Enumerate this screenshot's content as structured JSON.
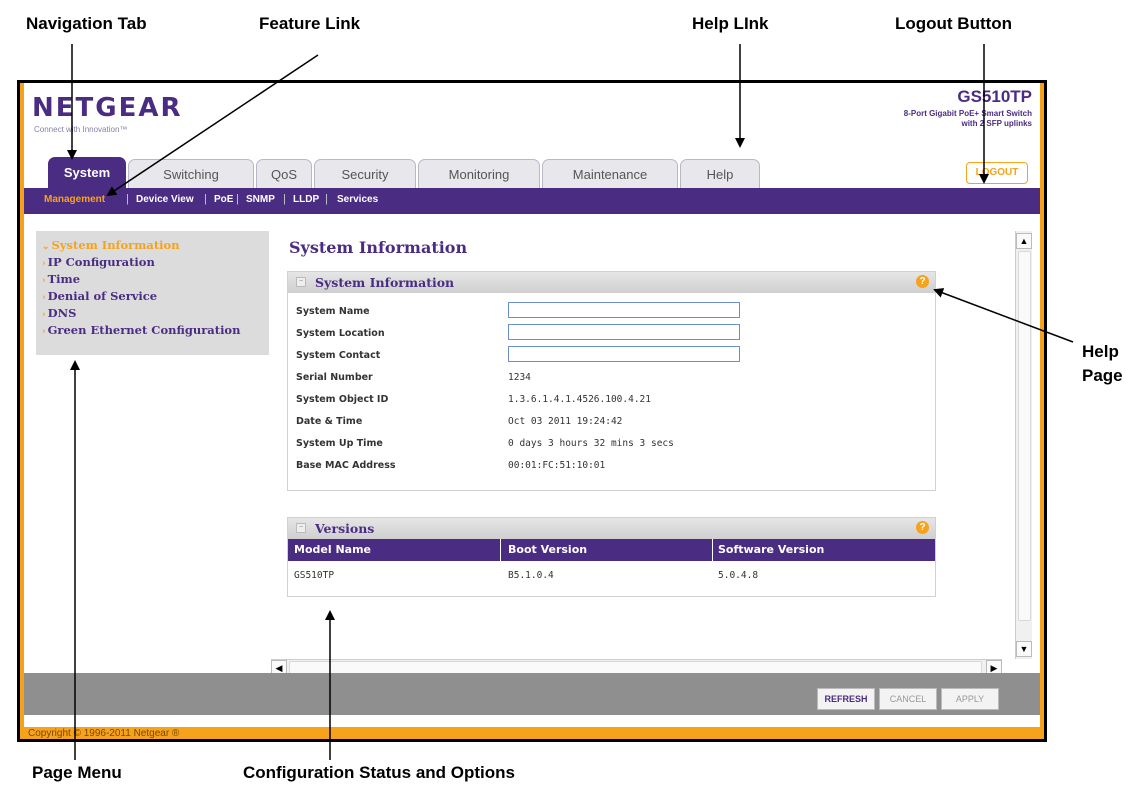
{
  "callouts": {
    "navigation_tab": "Navigation Tab",
    "feature_link": "Feature Link",
    "help_link": "Help LInk",
    "logout_button": "Logout Button",
    "help_page_1": "Help",
    "help_page_2": "Page",
    "page_menu": "Page Menu",
    "config_status": "Configuration Status and Options"
  },
  "brand": {
    "logo": "NETGEAR",
    "tagline": "Connect with Innovation™",
    "model": "GS510TP",
    "model_desc_1": "8-Port Gigabit PoE+ Smart Switch",
    "model_desc_2": "with 2 SFP uplinks",
    "logout": "LOGOUT"
  },
  "tabs": [
    {
      "label": "System",
      "active": true
    },
    {
      "label": "Switching"
    },
    {
      "label": "QoS"
    },
    {
      "label": "Security"
    },
    {
      "label": "Monitoring"
    },
    {
      "label": "Maintenance"
    },
    {
      "label": "Help"
    }
  ],
  "subnav": [
    "Management",
    "Device View",
    "PoE",
    "SNMP",
    "LLDP",
    "Services"
  ],
  "menu": [
    "System Information",
    "IP Configuration",
    "Time",
    "Denial of Service",
    "DNS",
    "Green Ethernet Configuration"
  ],
  "content": {
    "title": "System Information",
    "panel_title": "System Information",
    "fields": [
      {
        "label": "System Name",
        "value": ""
      },
      {
        "label": "System Location",
        "value": ""
      },
      {
        "label": "System Contact",
        "value": ""
      },
      {
        "label": "Serial Number",
        "value": "1234"
      },
      {
        "label": "System Object ID",
        "value": "1.3.6.1.4.1.4526.100.4.21"
      },
      {
        "label": "Date & Time",
        "value": "Oct 03 2011 19:24:42"
      },
      {
        "label": "System Up Time",
        "value": "0 days 3 hours 32 mins 3 secs"
      },
      {
        "label": "Base MAC Address",
        "value": "00:01:FC:51:10:01"
      }
    ],
    "versions_title": "Versions",
    "versions_headers": [
      "Model Name",
      "Boot Version",
      "Software Version"
    ],
    "versions_row": [
      "GS510TP",
      "B5.1.0.4",
      "5.0.4.8"
    ]
  },
  "footer": {
    "refresh": "REFRESH",
    "cancel": "CANCEL",
    "apply": "APPLY",
    "copyright": "Copyright © 1996-2011 Netgear ®"
  },
  "colors": {
    "purple": "#4b2c83",
    "orange": "#f7a21b"
  }
}
